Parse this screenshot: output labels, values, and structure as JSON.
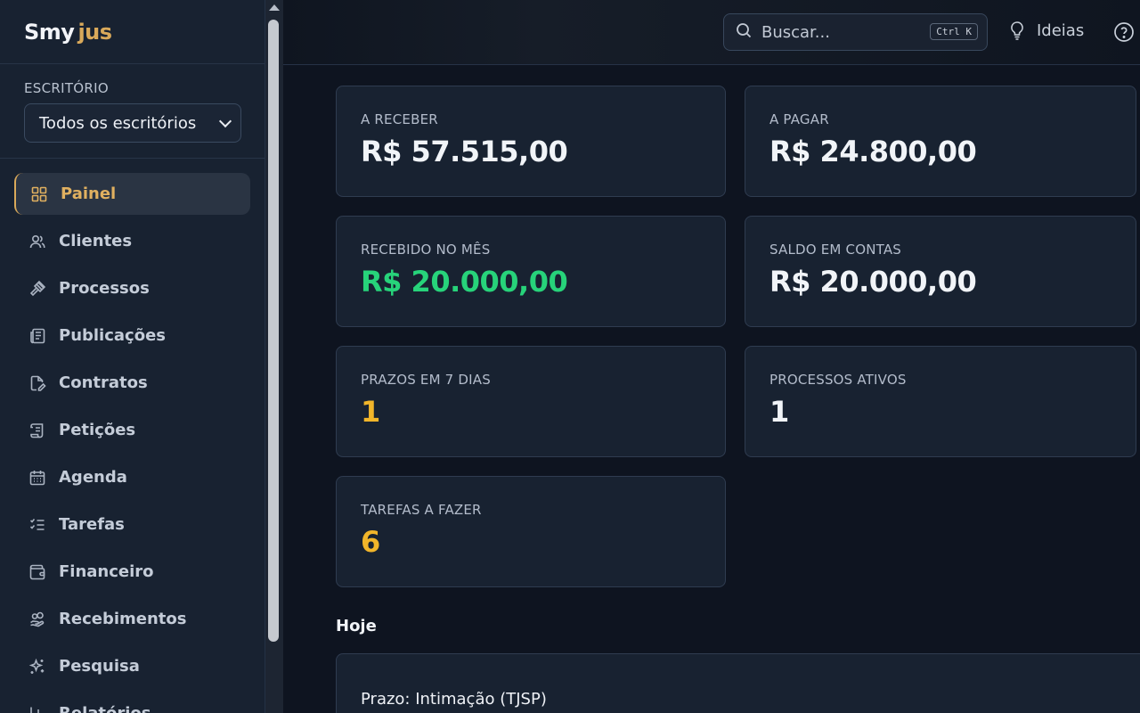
{
  "brand": {
    "part1": "Smy",
    "part2": "jus"
  },
  "office": {
    "label": "ESCRITÓRIO",
    "selected": "Todos os escritórios"
  },
  "nav": [
    {
      "label": "Painel",
      "icon": "grid-icon",
      "active": true
    },
    {
      "label": "Clientes",
      "icon": "users-icon"
    },
    {
      "label": "Processos",
      "icon": "gavel-icon"
    },
    {
      "label": "Publicações",
      "icon": "newspaper-icon"
    },
    {
      "label": "Contratos",
      "icon": "file-edit-icon"
    },
    {
      "label": "Petições",
      "icon": "scroll-icon"
    },
    {
      "label": "Agenda",
      "icon": "calendar-icon"
    },
    {
      "label": "Tarefas",
      "icon": "list-check-icon"
    },
    {
      "label": "Financeiro",
      "icon": "wallet-icon"
    },
    {
      "label": "Recebimentos",
      "icon": "hand-coins-icon"
    },
    {
      "label": "Pesquisa",
      "icon": "sparkles-icon"
    },
    {
      "label": "Relatórios",
      "icon": "bar-chart-icon"
    }
  ],
  "header": {
    "search_placeholder": "Buscar...",
    "search_shortcut": "Ctrl K",
    "ideas_label": "Ideias"
  },
  "cards": {
    "a_receber": {
      "label": "A RECEBER",
      "value": "R$ 57.515,00"
    },
    "a_pagar": {
      "label": "A PAGAR",
      "value": "R$ 24.800,00"
    },
    "recebido_mes": {
      "label": "RECEBIDO NO MÊS",
      "value": "R$ 20.000,00"
    },
    "saldo_contas": {
      "label": "SALDO EM CONTAS",
      "value": "R$ 20.000,00"
    },
    "prazos_7dias": {
      "label": "PRAZOS EM 7 DIAS",
      "value": "1"
    },
    "processos_ativos": {
      "label": "PROCESSOS ATIVOS",
      "value": "1"
    },
    "tarefas_fazer": {
      "label": "TAREFAS A FAZER",
      "value": "6"
    }
  },
  "today": {
    "title": "Hoje",
    "item": "Prazo: Intimação (TJSP)"
  },
  "colors": {
    "accent": "#d9a95a",
    "positive": "#27d37a",
    "warning": "#f1b52a"
  }
}
